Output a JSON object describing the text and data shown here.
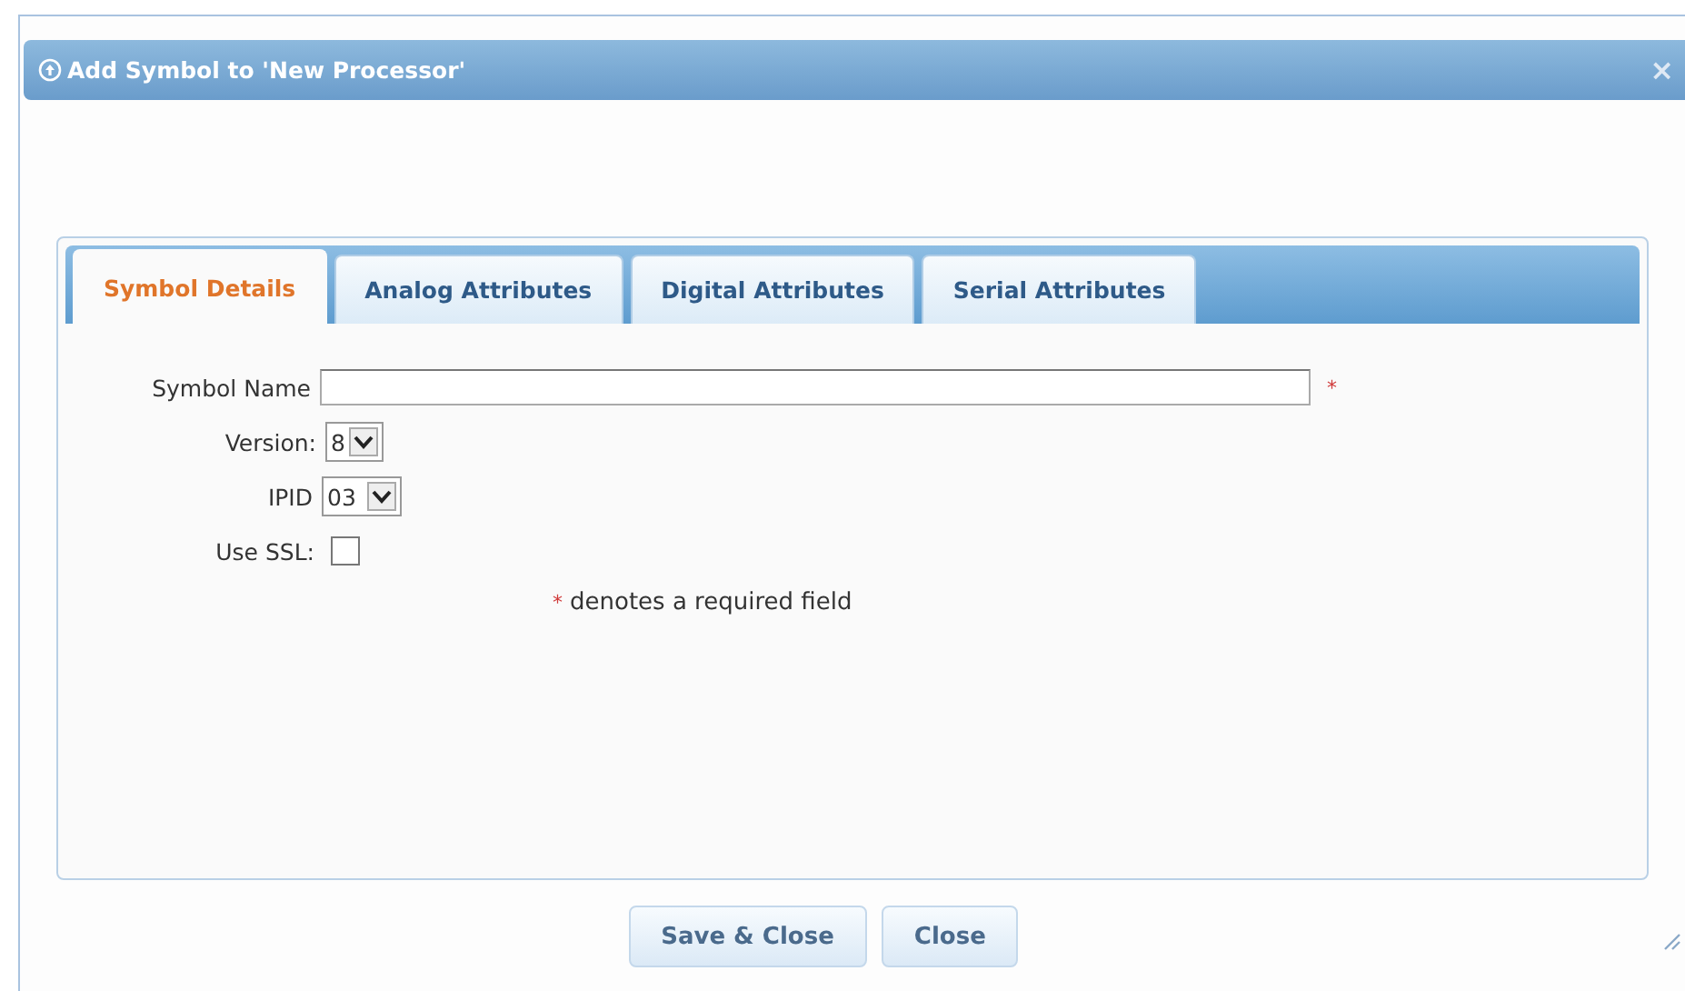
{
  "window": {
    "title": "Add Symbol to 'New Processor'",
    "close": "×"
  },
  "tabs": [
    {
      "label": "Symbol Details",
      "selected": true
    },
    {
      "label": "Analog Attributes",
      "selected": false
    },
    {
      "label": "Digital Attributes",
      "selected": false
    },
    {
      "label": "Serial Attributes",
      "selected": false
    }
  ],
  "form": {
    "symbol_name": {
      "label": "Symbol Name",
      "required_mark": "*"
    },
    "version": {
      "label": "Version:",
      "value": "8"
    },
    "ipid": {
      "label": "IPID",
      "value": "03"
    },
    "use_ssl": {
      "label": "Use SSL:",
      "checked": false
    },
    "required_note": {
      "mark": "*",
      "text": "denotes a required field"
    }
  },
  "buttons": [
    "Save & Close",
    "Close"
  ]
}
